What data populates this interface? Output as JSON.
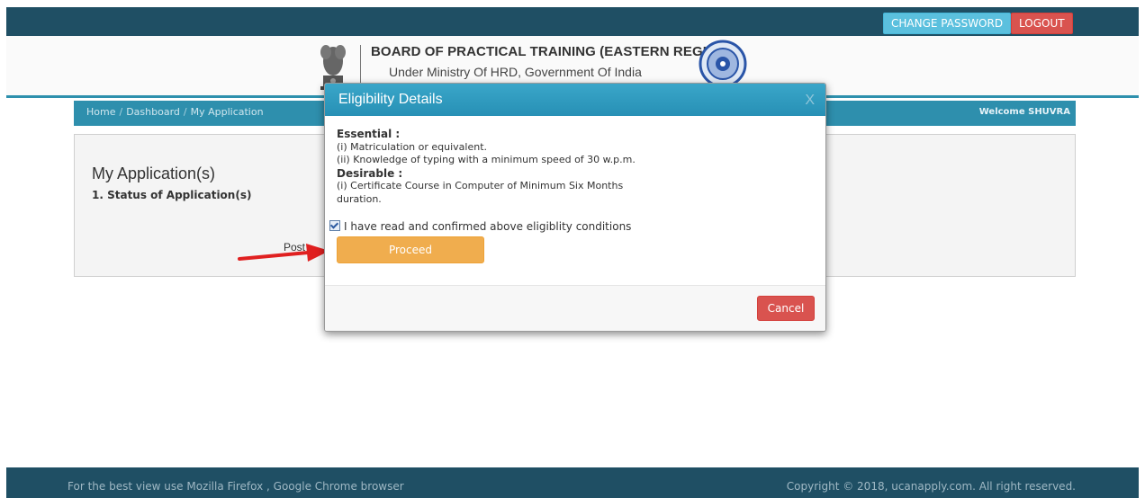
{
  "topbar": {
    "change_password": "CHANGE PASSWORD",
    "logout": "LOGOUT"
  },
  "header": {
    "title": "BOARD OF PRACTICAL TRAINING (EASTERN REGION)",
    "subtitle": "Under Ministry Of HRD, Government Of India"
  },
  "breadcrumb": {
    "items": [
      "Home",
      "Dashboard",
      "My Application"
    ],
    "separator": "/",
    "welcome": "Welcome SHUVRA"
  },
  "page": {
    "title": "My Application(s)",
    "section": "1. Status of Application(s)",
    "post_label": "Post"
  },
  "modal": {
    "title": "Eligibility Details",
    "close": "X",
    "essential_heading": "Essential :",
    "essential_items": [
      "(i) Matriculation or equivalent.",
      "(ii) Knowledge of typing with a minimum speed of 30 w.p.m."
    ],
    "desirable_heading": "Desirable :",
    "desirable_items": [
      "(i) Certificate Course in Computer of Minimum Six Months",
      "duration."
    ],
    "confirm_text": "I have read and confirmed above eligiblity conditions",
    "confirm_checked": true,
    "proceed": "Proceed",
    "cancel": "Cancel"
  },
  "footer": {
    "left": "For the best view use Mozilla Firefox , Google Chrome browser",
    "right": "Copyright © 2018, ucanapply.com. All right reserved."
  },
  "colors": {
    "topbar": "#1f4f64",
    "accent": "#2e8fad",
    "proceed": "#f0ad4e",
    "danger": "#d9534f",
    "info": "#5bc0de",
    "annotation_arrow": "#e02020"
  }
}
